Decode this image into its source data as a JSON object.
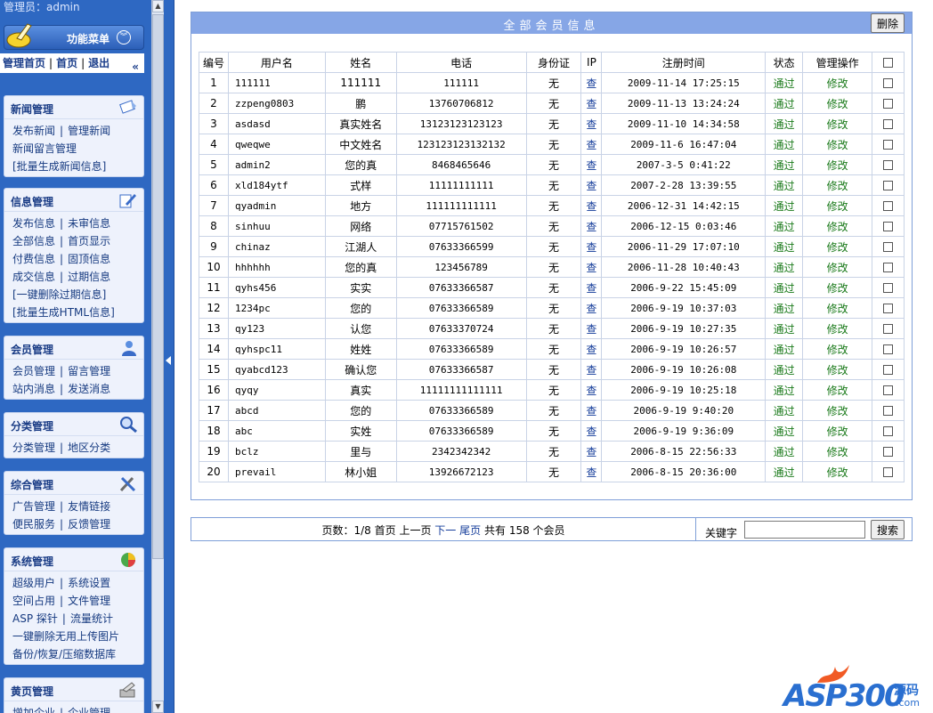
{
  "sidebar": {
    "admin_label": "管理员：admin",
    "menu_title": "功能菜单",
    "nav": [
      "管理首页",
      "首页",
      "退出"
    ],
    "sections": [
      {
        "title": "新闻管理",
        "icon": "news-icon",
        "lines": [
          [
            "发布新闻",
            "管理新闻"
          ],
          [
            "新闻留言管理"
          ],
          [
            "[批量生成新闻信息]"
          ]
        ]
      },
      {
        "title": "信息管理",
        "icon": "info-edit-icon",
        "lines": [
          [
            "发布信息",
            "未审信息"
          ],
          [
            "全部信息",
            "首页显示"
          ],
          [
            "付费信息",
            "固顶信息"
          ],
          [
            "成交信息",
            "过期信息"
          ],
          [
            "[一键删除过期信息]"
          ],
          [
            "[批量生成HTML信息]"
          ]
        ]
      },
      {
        "title": "会员管理",
        "icon": "member-icon",
        "lines": [
          [
            "会员管理",
            "留言管理"
          ],
          [
            "站内消息",
            "发送消息"
          ]
        ]
      },
      {
        "title": "分类管理",
        "icon": "magnifier-icon",
        "lines": [
          [
            "分类管理",
            "地区分类"
          ]
        ]
      },
      {
        "title": "综合管理",
        "icon": "tools-icon",
        "lines": [
          [
            "广告管理",
            "友情链接"
          ],
          [
            "便民服务",
            "反馈管理"
          ]
        ]
      },
      {
        "title": "系统管理",
        "icon": "system-icon",
        "lines": [
          [
            "超级用户",
            "系统设置"
          ],
          [
            "空间占用",
            "文件管理"
          ],
          [
            "ASP 探针",
            "流量统计"
          ],
          [
            "一键删除无用上传图片"
          ],
          [
            "备份/恢复/压缩数据库"
          ]
        ]
      },
      {
        "title": "黄页管理",
        "icon": "yellowpage-icon",
        "lines": [
          [
            "增加企业",
            "企业管理"
          ]
        ]
      }
    ]
  },
  "panel": {
    "title": "全部会员信息",
    "delete_label": "删除",
    "columns": [
      "编号",
      "用户名",
      "姓名",
      "电话",
      "身份证",
      "IP",
      "注册时间",
      "状态",
      "管理操作",
      ""
    ],
    "rows": [
      [
        "1",
        "111111",
        "111111",
        "111111",
        "无",
        "查",
        "2009-11-14 17:25:15",
        "通过",
        "修改"
      ],
      [
        "2",
        "zzpeng0803",
        "鹏",
        "13760706812",
        "无",
        "查",
        "2009-11-13 13:24:24",
        "通过",
        "修改"
      ],
      [
        "3",
        "asdasd",
        "真实姓名",
        "13123123123123",
        "无",
        "查",
        "2009-11-10 14:34:58",
        "通过",
        "修改"
      ],
      [
        "4",
        "qweqwe",
        "中文姓名",
        "123123123132132",
        "无",
        "查",
        "2009-11-6 16:47:04",
        "通过",
        "修改"
      ],
      [
        "5",
        "admin2",
        "您的真",
        "8468465646",
        "无",
        "查",
        "2007-3-5 0:41:22",
        "通过",
        "修改"
      ],
      [
        "6",
        "xld184ytf",
        "式样",
        "11111111111",
        "无",
        "查",
        "2007-2-28 13:39:55",
        "通过",
        "修改"
      ],
      [
        "7",
        "qyadmin",
        "地方",
        "111111111111",
        "无",
        "查",
        "2006-12-31 14:42:15",
        "通过",
        "修改"
      ],
      [
        "8",
        "sinhuu",
        "网络",
        "07715761502",
        "无",
        "查",
        "2006-12-15 0:03:46",
        "通过",
        "修改"
      ],
      [
        "9",
        "chinaz",
        "江湖人",
        "07633366599",
        "无",
        "查",
        "2006-11-29 17:07:10",
        "通过",
        "修改"
      ],
      [
        "10",
        "hhhhhh",
        "您的真",
        "123456789",
        "无",
        "查",
        "2006-11-28 10:40:43",
        "通过",
        "修改"
      ],
      [
        "11",
        "qyhs456",
        "实实",
        "07633366587",
        "无",
        "查",
        "2006-9-22 15:45:09",
        "通过",
        "修改"
      ],
      [
        "12",
        "1234pc",
        "您的",
        "07633366589",
        "无",
        "查",
        "2006-9-19 10:37:03",
        "通过",
        "修改"
      ],
      [
        "13",
        "qy123",
        "认您",
        "07633370724",
        "无",
        "查",
        "2006-9-19 10:27:35",
        "通过",
        "修改"
      ],
      [
        "14",
        "qyhspc11",
        "姓姓",
        "07633366589",
        "无",
        "查",
        "2006-9-19 10:26:57",
        "通过",
        "修改"
      ],
      [
        "15",
        "qyabcd123",
        "确认您",
        "07633366587",
        "无",
        "查",
        "2006-9-19 10:26:08",
        "通过",
        "修改"
      ],
      [
        "16",
        "qyqy",
        "真实",
        "11111111111111",
        "无",
        "查",
        "2006-9-19 10:25:18",
        "通过",
        "修改"
      ],
      [
        "17",
        "abcd",
        "您的",
        "07633366589",
        "无",
        "查",
        "2006-9-19 9:40:20",
        "通过",
        "修改"
      ],
      [
        "18",
        "abc",
        "实姓",
        "07633366589",
        "无",
        "查",
        "2006-9-19 9:36:09",
        "通过",
        "修改"
      ],
      [
        "19",
        "bclz",
        "里与",
        "2342342342",
        "无",
        "查",
        "2006-8-15 22:56:33",
        "通过",
        "修改"
      ],
      [
        "20",
        "prevail",
        "林小姐",
        "13926672123",
        "无",
        "查",
        "2006-8-15 20:36:00",
        "通过",
        "修改"
      ]
    ]
  },
  "pager": {
    "pages_prefix": "页数：",
    "pages_value": "1/8",
    "first": "首页",
    "prev": "上一页",
    "next": "下一",
    "last": "尾页",
    "total_prefix": "共有",
    "total_count": "158",
    "total_suffix": "个会员",
    "keyword_label": "关键字",
    "keyword_value": "",
    "search_label": "搜索"
  },
  "logo": {
    "brand": "ASP300",
    "cn": "源码",
    "domain": ".com"
  },
  "colors": {
    "sidebar_blue": "#2e68c2",
    "panel_head": "#86a6e6",
    "status_green": "#1a7a1a",
    "link_blue": "#143c9a"
  }
}
